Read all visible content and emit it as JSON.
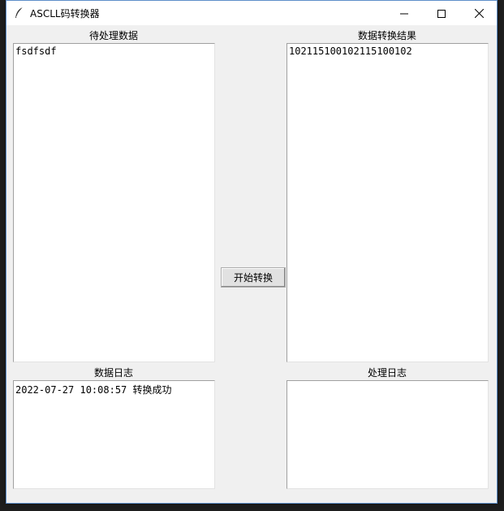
{
  "window": {
    "title": "ASCLL码转换器"
  },
  "panels": {
    "input": {
      "label": "待处理数据",
      "value": "fsdfsdf"
    },
    "output": {
      "label": "数据转换结果",
      "value": "102115100102115100102"
    },
    "data_log": {
      "label": "数据日志",
      "value": "2022-07-27 10:08:57 转换成功"
    },
    "process_log": {
      "label": "处理日志",
      "value": ""
    }
  },
  "actions": {
    "convert_label": "开始转换"
  },
  "icons": {
    "app": "feather-icon",
    "minimize": "minimize-icon",
    "maximize": "maximize-icon",
    "close": "close-icon"
  },
  "colors": {
    "window_bg": "#f0f0f0",
    "titlebar_bg": "#ffffff",
    "textbox_bg": "#ffffff"
  }
}
